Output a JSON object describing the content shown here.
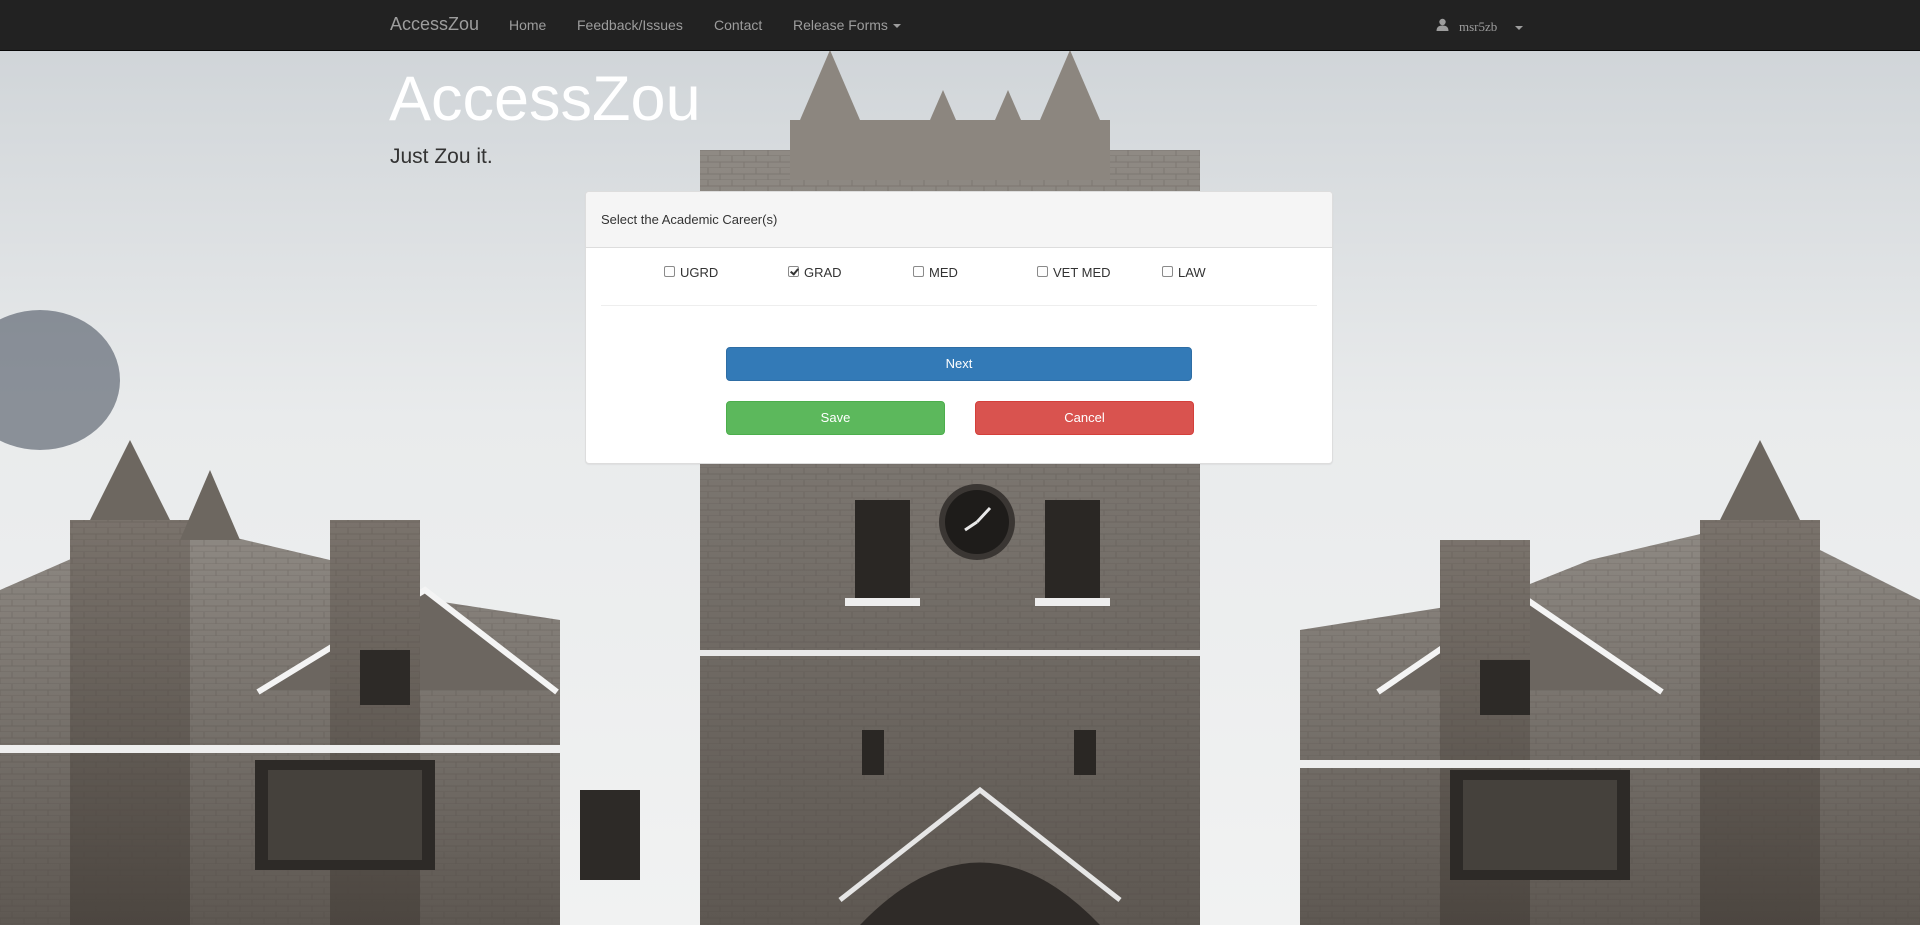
{
  "navbar": {
    "brand": "AccessZou",
    "links": {
      "home": "Home",
      "feedback": "Feedback/Issues",
      "contact": "Contact",
      "release_forms": "Release Forms"
    },
    "user": {
      "username": "msr5zb"
    }
  },
  "hero": {
    "title": "AccessZou",
    "subtitle": "Just Zou it."
  },
  "panel": {
    "heading": "Select the Academic Career(s)",
    "careers": [
      {
        "label": "UGRD",
        "checked": false
      },
      {
        "label": "GRAD",
        "checked": true
      },
      {
        "label": "MED",
        "checked": false
      },
      {
        "label": "VET MED",
        "checked": false
      },
      {
        "label": "LAW",
        "checked": false
      }
    ],
    "buttons": {
      "next": "Next",
      "save": "Save",
      "cancel": "Cancel"
    }
  },
  "colors": {
    "navbar_bg": "#222222",
    "primary": "#337ab7",
    "success": "#5cb85c",
    "danger": "#d9534f"
  }
}
